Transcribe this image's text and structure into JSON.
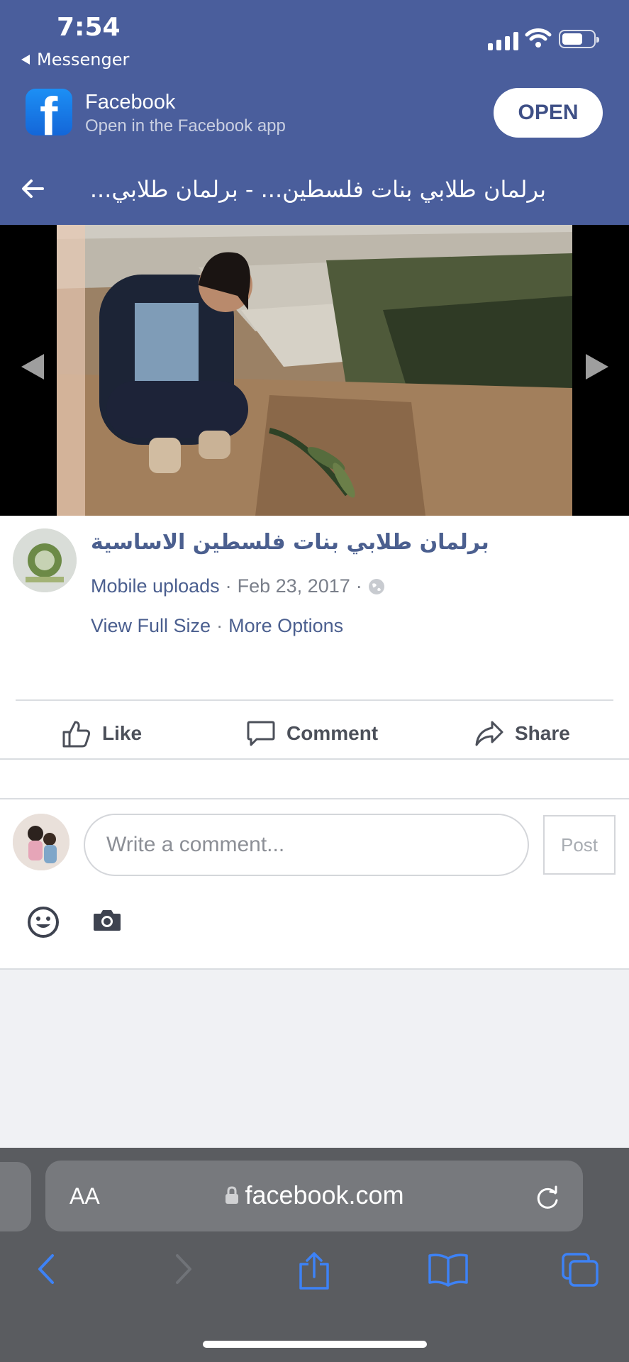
{
  "status_bar": {
    "time": "7:54",
    "back_app": "Messenger"
  },
  "app_banner": {
    "title": "Facebook",
    "subtitle": "Open in the Facebook app",
    "open_label": "OPEN"
  },
  "nav": {
    "page_title": "برلمان طلابي بنات فلسطين... - برلمان طلابي..."
  },
  "post": {
    "page_name": "برلمان طلابي بنات فلسطين الاساسية",
    "source": "Mobile uploads",
    "separator": "·",
    "date": "Feb 23, 2017",
    "view_full_size": "View Full Size",
    "more_options": "More Options",
    "privacy_icon": "globe-icon"
  },
  "actions": {
    "like": "Like",
    "comment": "Comment",
    "share": "Share"
  },
  "comment_box": {
    "placeholder": "Write a comment...",
    "post_label": "Post"
  },
  "browser": {
    "text_size": "AA",
    "url": "facebook.com"
  },
  "colors": {
    "header_bg": "#4a5e9c",
    "link": "#4b5f8f",
    "safari_tint": "#3d82f6",
    "toolbar_bg": "#5a5c60"
  }
}
